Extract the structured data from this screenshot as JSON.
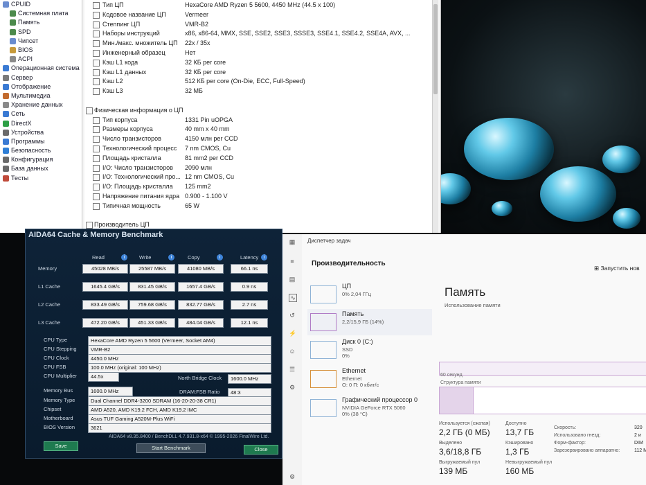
{
  "colors": {
    "aida_accent": "#1c4f8a",
    "bench_bg": "#0e2338",
    "green_button": "#1e7a4f",
    "memory_graph": "#9c6bb0"
  },
  "tree": [
    {
      "label": "CPUID",
      "icon": "cpuid-icon",
      "color": "#6a8ccf"
    },
    {
      "label": "Системная плата",
      "icon": "motherboard-icon",
      "color": "#4c8a4c"
    },
    {
      "label": "Память",
      "icon": "memory-icon",
      "color": "#4c8a4c"
    },
    {
      "label": "SPD",
      "icon": "spd-icon",
      "color": "#4c8a4c"
    },
    {
      "label": "Чипсет",
      "icon": "chipset-icon",
      "color": "#6a8ccf"
    },
    {
      "label": "BIOS",
      "icon": "bios-icon",
      "color": "#c79a3a"
    },
    {
      "label": "ACPI",
      "icon": "acpi-icon",
      "color": "#8a8a8a"
    },
    {
      "label": "Операционная система",
      "icon": "os-icon",
      "color": "#3a7ad3"
    },
    {
      "label": "Сервер",
      "icon": "server-icon",
      "color": "#7a7a7a"
    },
    {
      "label": "Отображение",
      "icon": "display-icon",
      "color": "#3a7ad3"
    },
    {
      "label": "Мультимедиа",
      "icon": "multimedia-icon",
      "color": "#c26b2f"
    },
    {
      "label": "Хранение данных",
      "icon": "storage-icon",
      "color": "#8a8a8a"
    },
    {
      "label": "Сеть",
      "icon": "network-icon",
      "color": "#3a7ad3"
    },
    {
      "label": "DirectX",
      "icon": "directx-icon",
      "color": "#2d9f45"
    },
    {
      "label": "Устройства",
      "icon": "devices-icon",
      "color": "#6a6a6a"
    },
    {
      "label": "Программы",
      "icon": "programs-icon",
      "color": "#3a7ad3"
    },
    {
      "label": "Безопасность",
      "icon": "security-icon",
      "color": "#2f7fd6"
    },
    {
      "label": "Конфигурация",
      "icon": "config-icon",
      "color": "#6a6a6a"
    },
    {
      "label": "База данных",
      "icon": "database-icon",
      "color": "#6a6a6a"
    },
    {
      "label": "Тесты",
      "icon": "tests-icon",
      "color": "#c04a3a"
    }
  ],
  "props": [
    {
      "label": "Тип ЦП",
      "value": "HexaCore AMD Ryzen 5 5600, 4450 MHz (44.5 x 100)",
      "indent": 1
    },
    {
      "label": "Кодовое название ЦП",
      "value": "Vermeer",
      "indent": 1
    },
    {
      "label": "Степпинг ЦП",
      "value": "VMR-B2",
      "indent": 1
    },
    {
      "label": "Наборы инструкций",
      "value": "x86, x86-64, MMX, SSE, SSE2, SSE3, SSSE3, SSE4.1, SSE4.2, SSE4A, AVX, ...",
      "indent": 1
    },
    {
      "label": "Мин./макс. множитель ЦП",
      "value": "22x / 35x",
      "indent": 1
    },
    {
      "label": "Инженерный образец",
      "value": "Нет",
      "indent": 1
    },
    {
      "label": "Кэш L1 кода",
      "value": "32 КБ per core",
      "indent": 1
    },
    {
      "label": "Кэш L1 данных",
      "value": "32 КБ per core",
      "indent": 1
    },
    {
      "label": "Кэш L2",
      "value": "512 КБ per core  (On-Die, ECC, Full-Speed)",
      "indent": 1
    },
    {
      "label": "Кэш L3",
      "value": "32 МБ",
      "indent": 1
    },
    {
      "label": "",
      "value": "",
      "indent": 0
    },
    {
      "label": "Физическая информация о ЦП",
      "value": "",
      "indent": 0
    },
    {
      "label": "Тип корпуса",
      "value": "1331 Pin uOPGA",
      "indent": 1
    },
    {
      "label": "Размеры корпуса",
      "value": "40 mm x 40 mm",
      "indent": 1
    },
    {
      "label": "Число транзисторов",
      "value": "4150 млн per CCD",
      "indent": 1
    },
    {
      "label": "Технологический процесс",
      "value": "7 nm CMOS, Cu",
      "indent": 1
    },
    {
      "label": "Площадь кристалла",
      "value": "81 mm2 per CCD",
      "indent": 1
    },
    {
      "label": "I/O: Число транзисторов",
      "value": "2090 млн",
      "indent": 1
    },
    {
      "label": "I/O: Технологический про...",
      "value": "12 nm CMOS, Cu",
      "indent": 1
    },
    {
      "label": "I/O: Площадь кристалла",
      "value": "125 mm2",
      "indent": 1
    },
    {
      "label": "Напряжение питания ядра",
      "value": "0.900 - 1.100 V",
      "indent": 1
    },
    {
      "label": "Типичная мощность",
      "value": "65 W",
      "indent": 1
    },
    {
      "label": "",
      "value": "",
      "indent": 0
    },
    {
      "label": "Производитель ЦП",
      "value": "",
      "indent": 0
    }
  ],
  "bench": {
    "title": "AIDA64 Cache & Memory Benchmark",
    "columns": [
      "Read",
      "Write",
      "Copy",
      "Latency"
    ],
    "rows": [
      {
        "label": "Memory",
        "values": [
          "45028 MB/s",
          "25587 MB/s",
          "41080 MB/s",
          "66.1 ns"
        ]
      },
      {
        "label": "L1 Cache",
        "values": [
          "1645.4 GB/s",
          "831.45 GB/s",
          "1657.4 GB/s",
          "0.9 ns"
        ]
      },
      {
        "label": "L2 Cache",
        "values": [
          "833.49 GB/s",
          "759.68 GB/s",
          "832.77 GB/s",
          "2.7 ns"
        ]
      },
      {
        "label": "L3 Cache",
        "values": [
          "472.20 GB/s",
          "451.33 GB/s",
          "484.04 GB/s",
          "12.1 ns"
        ]
      }
    ],
    "cpu_type_label": "CPU Type",
    "cpu_type": "HexaCore AMD Ryzen 5 5600  (Vermeer, Socket AM4)",
    "cpu_stepping_label": "CPU Stepping",
    "cpu_stepping": "VMR-B2",
    "cpu_clock_label": "CPU Clock",
    "cpu_clock": "4450.0 MHz",
    "cpu_fsb_label": "CPU FSB",
    "cpu_fsb": "100.0 MHz  (original: 100 MHz)",
    "cpu_mult_label": "CPU Multiplier",
    "cpu_mult": "44.5x",
    "nb_clock_label": "North Bridge Clock",
    "nb_clock": "1600.0 MHz",
    "mem_bus_label": "Memory Bus",
    "mem_bus": "1600.0 MHz",
    "dram_fsb_label": "DRAM:FSB Ratio",
    "dram_fsb": "48:3",
    "mem_type_label": "Memory Type",
    "mem_type": "Dual Channel DDR4-3200 SDRAM  (16-20-20-38 CR1)",
    "chipset_label": "Chipset",
    "chipset": "AMD A520, AMD K19.2 FCH, AMD K19.2 IMC",
    "mobo_label": "Motherboard",
    "mobo": "Asus TUF Gaming A520M-Plus WiFi",
    "bios_label": "BIOS Version",
    "bios": "3621",
    "footer": "AIDA64 v8.35.8400 / BenchDLL 4.7.931.8-x64  © 1995-2026 FinalWire Ltd.",
    "save": "Save",
    "start": "Start Benchmark",
    "close": "Close"
  },
  "tm": {
    "title": "Диспетчер задач",
    "section": "Производительность",
    "run_task": "Запустить нов",
    "items": [
      {
        "name": "ЦП",
        "sub": "0% 2,04 ГГц",
        "sub2": ""
      },
      {
        "name": "Память",
        "sub": "2,2/15,9 ГБ (14%)",
        "sub2": ""
      },
      {
        "name": "Диск 0 (C:)",
        "sub": "SSD",
        "sub2": "0%"
      },
      {
        "name": "Ethernet",
        "sub": "Ethernet",
        "sub2": "О: 0 П: 0 кбит/с"
      },
      {
        "name": "Графический процессор 0",
        "sub": "NVIDIA GeForce RTX 5060",
        "sub2": "0% (38 °C)"
      }
    ],
    "mem_title": "Память",
    "mem_usage_label": "Использование памяти",
    "seconds_label": "60 секунд",
    "structure_label": "Структура памяти",
    "stats": [
      {
        "label": "Используется (сжатая)",
        "value": "2,2 ГБ (0 МБ)"
      },
      {
        "label": "Доступно",
        "value": "13,7 ГБ"
      },
      {
        "label": "Выделено",
        "value": "3,6/18,8 ГБ"
      },
      {
        "label": "Кэшировано",
        "value": "1,3 ГБ"
      },
      {
        "label": "Выгружаемый пул",
        "value": "139 МБ"
      },
      {
        "label": "Невыгружаемый пул",
        "value": "160 МБ"
      }
    ],
    "right_stats": [
      {
        "label": "Скорость:",
        "value": "320"
      },
      {
        "label": "Использовано гнезд:",
        "value": "2 и"
      },
      {
        "label": "Форм-фактор:",
        "value": "DIM"
      },
      {
        "label": "Зарезервировано аппаратно:",
        "value": "112 М"
      }
    ]
  }
}
